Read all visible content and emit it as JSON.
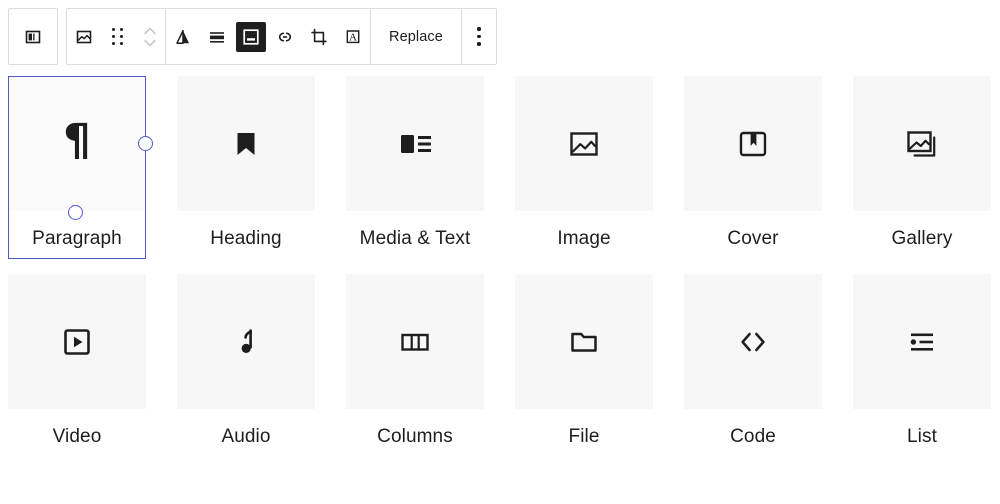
{
  "toolbar": {
    "buttons": [
      {
        "id": "block-type-switcher",
        "icon": "block-switcher-icon",
        "label": "",
        "state": "default"
      },
      {
        "id": "image-block-icon",
        "icon": "image-icon",
        "label": "",
        "state": "default"
      },
      {
        "id": "drag-handle",
        "icon": "drag-dots-icon",
        "label": "",
        "state": "default"
      },
      {
        "id": "move-updown",
        "icon": "chevron-up-down-icon",
        "label": "",
        "state": "disabled"
      },
      {
        "id": "align",
        "icon": "align-triangle-icon",
        "label": "",
        "state": "default"
      },
      {
        "id": "align-full",
        "icon": "align-lines-icon",
        "label": "",
        "state": "default"
      },
      {
        "id": "align-center-selected",
        "icon": "align-center-framed-icon",
        "label": "",
        "state": "selected"
      },
      {
        "id": "link",
        "icon": "link-icon",
        "label": "",
        "state": "default"
      },
      {
        "id": "crop",
        "icon": "crop-icon",
        "label": "",
        "state": "default"
      },
      {
        "id": "text-overlay",
        "icon": "letter-a-framed-icon",
        "label": "",
        "state": "default"
      },
      {
        "id": "replace",
        "icon": "",
        "label": "Replace",
        "state": "default"
      },
      {
        "id": "more-options",
        "icon": "three-dots-vertical-icon",
        "label": "",
        "state": "default"
      }
    ],
    "replace_label": "Replace"
  },
  "grid": {
    "selected_index": 0,
    "selection_color": "#4f59c9",
    "tile_background": "#f7f7f7",
    "items": [
      {
        "label": "Paragraph",
        "icon": "pilcrow-icon"
      },
      {
        "label": "Heading",
        "icon": "bookmark-icon"
      },
      {
        "label": "Media & Text",
        "icon": "media-and-text-icon"
      },
      {
        "label": "Image",
        "icon": "image-icon"
      },
      {
        "label": "Cover",
        "icon": "cover-book-icon"
      },
      {
        "label": "Gallery",
        "icon": "gallery-icon"
      },
      {
        "label": "Video",
        "icon": "video-play-icon"
      },
      {
        "label": "Audio",
        "icon": "music-note-icon"
      },
      {
        "label": "Columns",
        "icon": "columns-icon"
      },
      {
        "label": "File",
        "icon": "folder-icon"
      },
      {
        "label": "Code",
        "icon": "angle-brackets-icon"
      },
      {
        "label": "List",
        "icon": "list-icon"
      }
    ]
  }
}
